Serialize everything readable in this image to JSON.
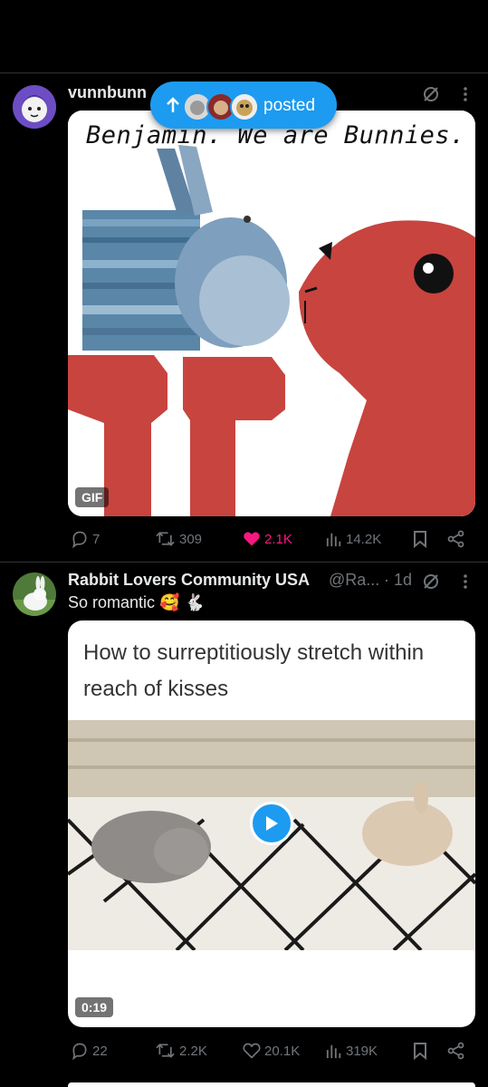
{
  "post1": {
    "username": "vunnbunn",
    "media_caption": "Benjamin. We are Bunnies.",
    "media_badge": "GIF",
    "actions": {
      "replies": "7",
      "reposts": "309",
      "likes": "2.1K",
      "views": "14.2K"
    },
    "liked": true
  },
  "banner": {
    "label": "posted"
  },
  "post2": {
    "display_name": "Rabbit Lovers Community USA",
    "handle": "@Ra...",
    "time": "· 1d",
    "text": "So romantic 🥰 🐇",
    "video_caption_line1": "How to surreptitiously stretch within",
    "video_caption_line2": "reach of kisses",
    "video_duration": "0:19",
    "actions": {
      "replies": "22",
      "reposts": "2.2K",
      "likes": "20.1K",
      "views": "319K"
    }
  },
  "colors": {
    "accent": "#1d9bf0",
    "like": "#f91880",
    "muted": "#71767b",
    "background": "#000000"
  },
  "icons": [
    "reply-icon",
    "repost-icon",
    "like-icon",
    "views-icon",
    "bookmark-icon",
    "share-icon",
    "grok-icon",
    "more-icon",
    "play-icon",
    "up-arrow-icon"
  ]
}
